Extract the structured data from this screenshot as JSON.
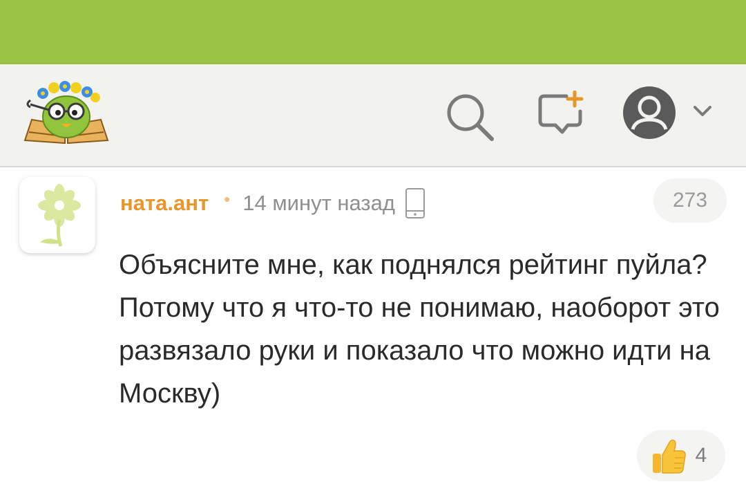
{
  "header": {
    "logo_icon": "owl-on-book-logo",
    "icons": [
      "search-icon",
      "add-post-icon",
      "avatar-icon",
      "chevron-down-icon"
    ]
  },
  "comment": {
    "author": "ната.ант",
    "separator": "•",
    "time": "14 минут назад",
    "device_icon": "phone-icon",
    "rating": "273",
    "text": "Объясните мне, как поднялся рейтинг пуйла? Потому что я что-то не понимаю, наоборот это развязало руки и показало что можно идти на Москву)",
    "likes": "4",
    "like_icon": "thumbs-up-icon"
  },
  "colors": {
    "status_bar": "#9cc244",
    "header_bg": "#f2f2ee",
    "username": "#e8962a",
    "avatar_flower": "#dbe9a0"
  }
}
